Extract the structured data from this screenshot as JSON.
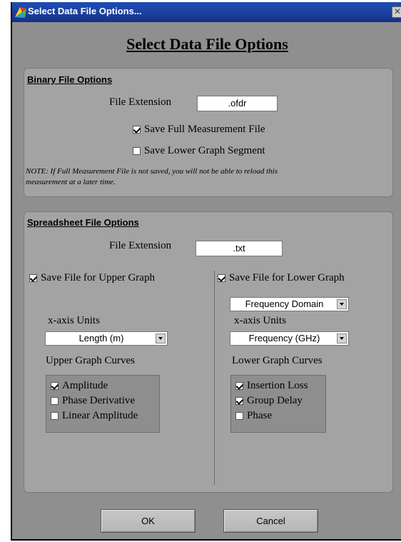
{
  "window": {
    "title": "Select Data File Options...",
    "close_glyph": "✕"
  },
  "main_title": "Select Data File Options",
  "binary": {
    "title": "Binary File Options",
    "extension_label": "File Extension",
    "extension_value": ".ofdr",
    "save_full": {
      "label": "Save Full Measurement File",
      "checked": true
    },
    "save_lower": {
      "label": "Save Lower Graph Segment",
      "checked": false
    },
    "note_line1": "NOTE: If Full Measurement File is not saved, you will not be able to reload this",
    "note_line2": "measurement at a later time."
  },
  "spreadsheet": {
    "title": "Spreadsheet File Options",
    "extension_label": "File Extension",
    "extension_value": ".txt",
    "upper": {
      "save_label": "Save File for Upper Graph",
      "save_checked": true,
      "xaxis_label": "x-axis Units",
      "xaxis_value": "Length (m)",
      "curves_label": "Upper Graph Curves",
      "curves": [
        {
          "label": "Amplitude",
          "checked": true
        },
        {
          "label": "Phase Derivative",
          "checked": false
        },
        {
          "label": "Linear Amplitude",
          "checked": false
        }
      ]
    },
    "lower": {
      "save_label": "Save File for Lower Graph",
      "save_checked": true,
      "domain_value": "Frequency Domain",
      "xaxis_label": "x-axis Units",
      "xaxis_value": "Frequency (GHz)",
      "curves_label": "Lower Graph Curves",
      "curves": [
        {
          "label": "Insertion Loss",
          "checked": true
        },
        {
          "label": "Group Delay",
          "checked": true
        },
        {
          "label": "Phase",
          "checked": false
        }
      ]
    }
  },
  "buttons": {
    "ok": "OK",
    "cancel": "Cancel"
  }
}
